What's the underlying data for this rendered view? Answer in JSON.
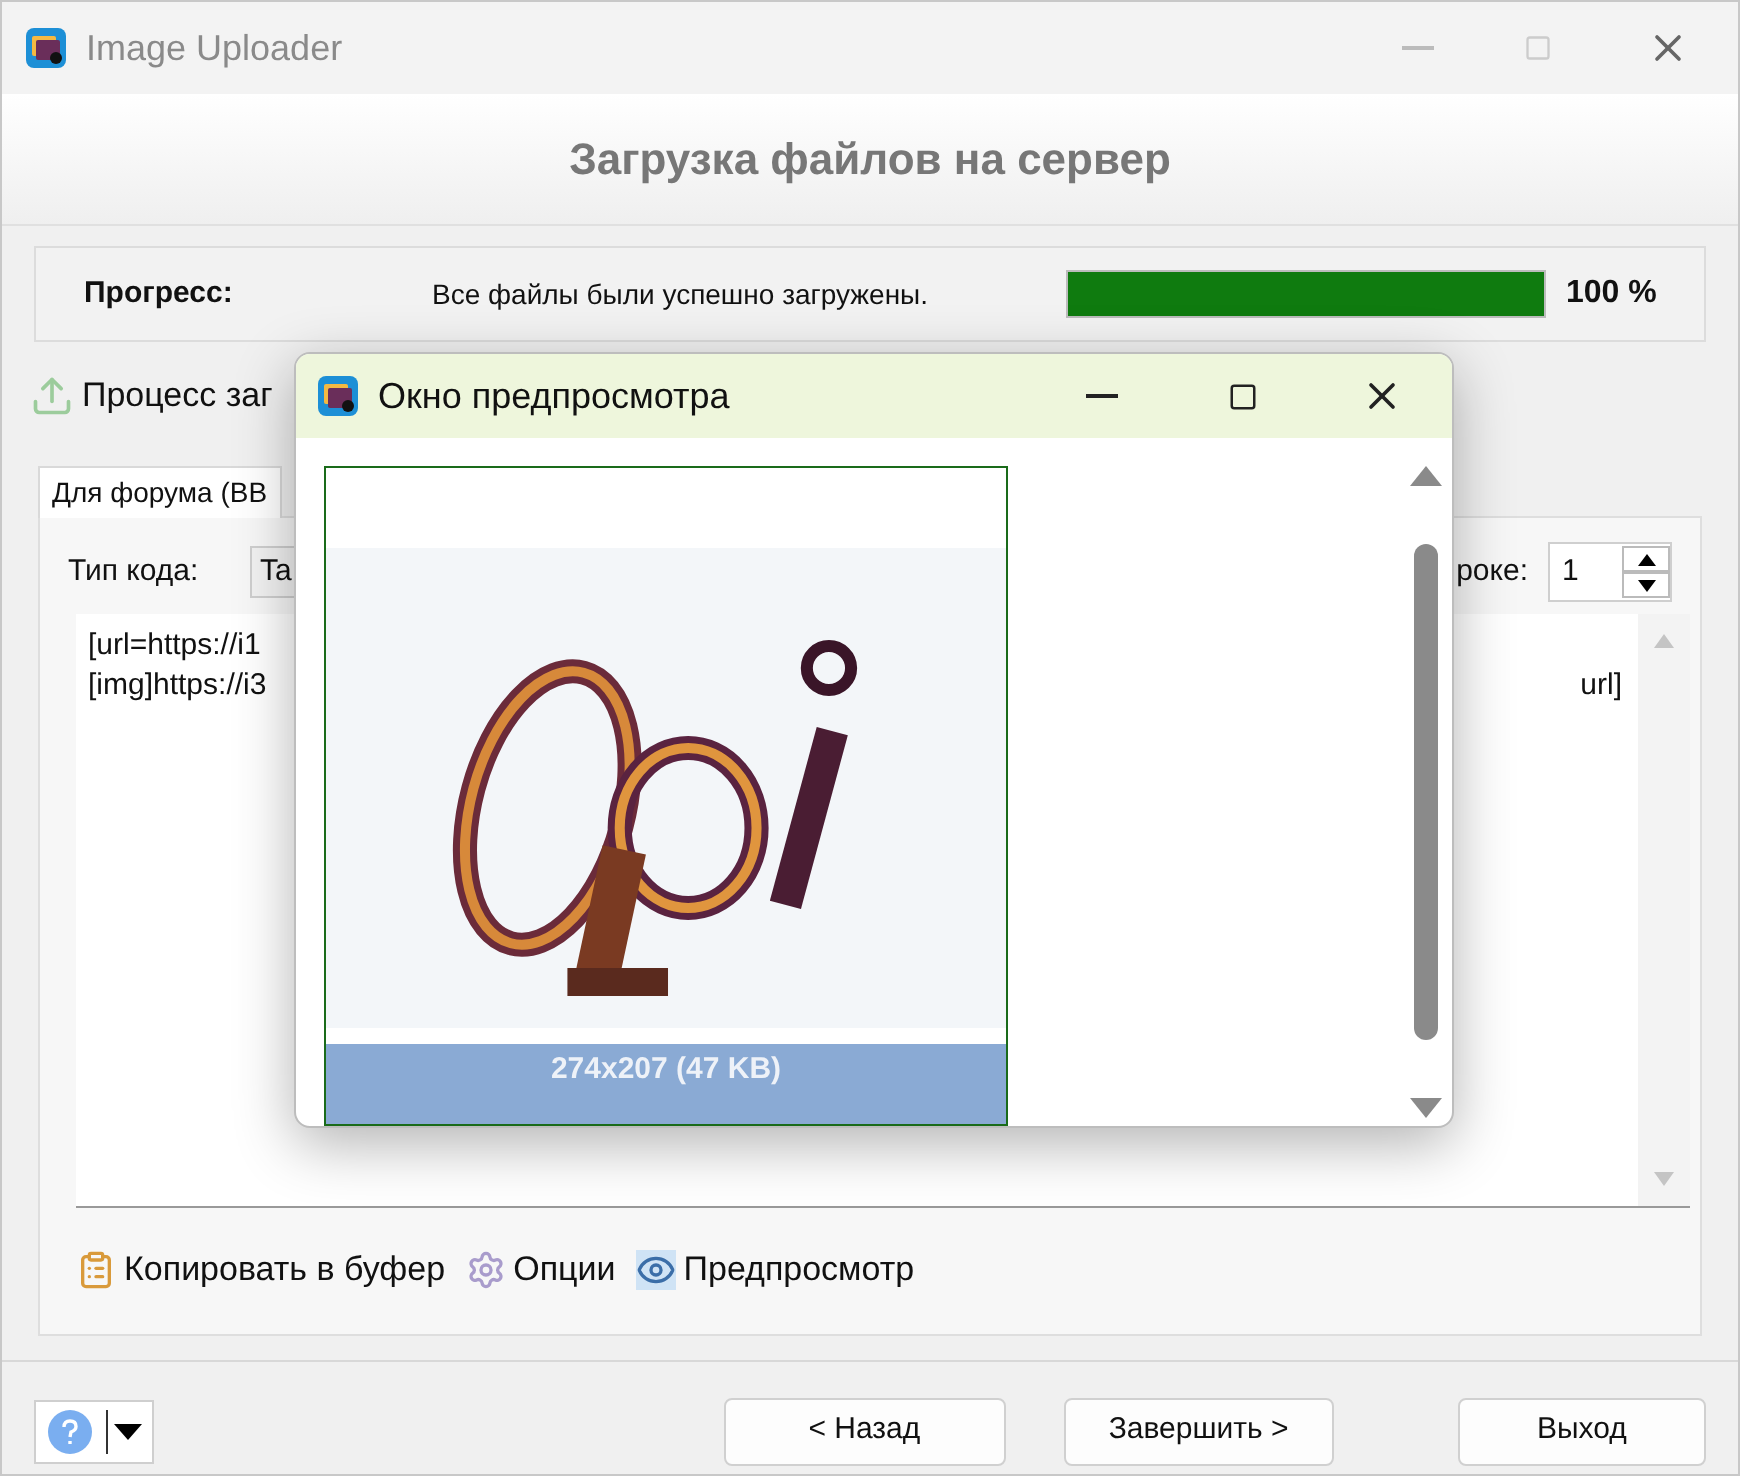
{
  "window": {
    "title": "Image Uploader"
  },
  "header": "Загрузка файлов на сервер",
  "progress": {
    "label": "Прогресс:",
    "message": "Все файлы были успешно загружены.",
    "level": 1,
    "reading": "100 %"
  },
  "section_label": "Процесс заг",
  "tabs": [
    {
      "label": "Для форума (BB",
      "selected": true
    }
  ],
  "code_type": {
    "label": "Тип кода:",
    "value": "Ta"
  },
  "per_row": {
    "label": "роке:",
    "value": "1"
  },
  "code_text": {
    "lines": [
      "[url=https://i1",
      "[img]https://i3"
    ],
    "line_2_end": "url]"
  },
  "actions": [
    {
      "kind": "clipboard",
      "label": "Копировать в буфер"
    },
    {
      "kind": "gear",
      "label": "Опции"
    },
    {
      "kind": "eye",
      "label": "Предпросмотр"
    }
  ],
  "buttons": [
    {
      "label": "< Назад"
    },
    {
      "label": "Завершить >"
    },
    {
      "label": "Выход"
    }
  ],
  "preview_window": {
    "title": "Окно предпросмотра",
    "caption": "274x207 (47 KB)",
    "kind": "picture"
  }
}
